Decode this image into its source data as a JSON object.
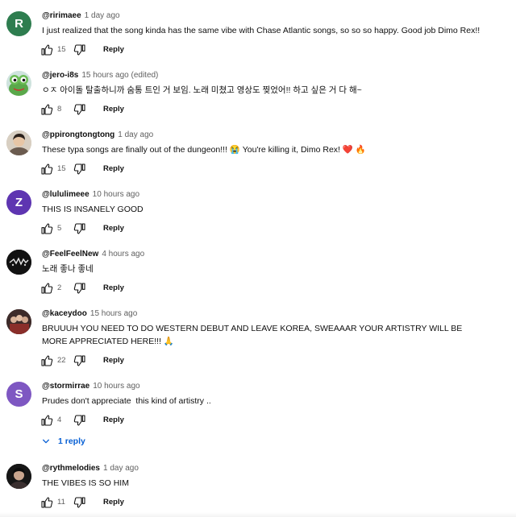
{
  "comments": [
    {
      "handle": "@ririmaee",
      "time": "1 day ago",
      "text": "I just realized that the song kinda has the same vibe with Chase Atlantic songs, so so so happy. Good job Dimo Rex!!",
      "likes": "15",
      "reply_label": "Reply",
      "avatar": {
        "type": "letter",
        "letter": "R",
        "color": "#2e7d4f"
      }
    },
    {
      "handle": "@jero-i8s",
      "time": "15 hours ago (edited)",
      "text": "ㅇㅈ 아이돌 탈출하니까 숨통 트인 거 보임. 노래 미쳤고 영상도 찢었어!! 하고 싶은 거 다 해~",
      "likes": "8",
      "reply_label": "Reply",
      "avatar": {
        "type": "image",
        "icon": "frog-avatar-icon"
      }
    },
    {
      "handle": "@ppirongtongtong",
      "time": "1 day ago",
      "text": "These typa songs are finally out of the dungeon!!! 😭 You're killing it, Dimo Rex! ❤️ 🔥",
      "likes": "15",
      "reply_label": "Reply",
      "avatar": {
        "type": "image",
        "icon": "person-photo-avatar-icon"
      }
    },
    {
      "handle": "@lululimeee",
      "time": "10 hours ago",
      "text": "THIS IS INSANELY GOOD",
      "likes": "5",
      "reply_label": "Reply",
      "avatar": {
        "type": "letter",
        "letter": "Z",
        "color": "#5e35b1"
      }
    },
    {
      "handle": "@FeelFeelNew",
      "time": "4 hours ago",
      "text": "노래 좋나 좋네",
      "likes": "2",
      "reply_label": "Reply",
      "avatar": {
        "type": "image",
        "icon": "dark-logo-avatar-icon"
      }
    },
    {
      "handle": "@kaceydoo",
      "time": "15 hours ago",
      "text": "BRUUUH YOU NEED TO DO WESTERN DEBUT AND LEAVE KOREA, SWEAAAR YOUR ARTISTRY WILL BE MORE APPRECIATED HERE!!! 🙏",
      "likes": "22",
      "reply_label": "Reply",
      "avatar": {
        "type": "image",
        "icon": "group-photo-avatar-icon"
      }
    },
    {
      "handle": "@stormirrae",
      "time": "10 hours ago",
      "text": "Prudes don't appreciate  this kind of artistry ..",
      "likes": "4",
      "reply_label": "Reply",
      "avatar": {
        "type": "letter",
        "letter": "S",
        "color": "#7e57c2"
      }
    },
    {
      "handle": "@rythmelodies",
      "time": "1 day ago",
      "text": "THE VIBES IS SO HIM",
      "likes": "11",
      "reply_label": "Reply",
      "avatar": {
        "type": "image",
        "icon": "dark-portrait-avatar-icon"
      }
    }
  ],
  "replies_toggle": {
    "label": "1 reply",
    "icon": "chevron-down-icon",
    "color": "#065fd4"
  },
  "icons": {
    "like": "thumbs-up-icon",
    "dislike": "thumbs-down-icon"
  }
}
